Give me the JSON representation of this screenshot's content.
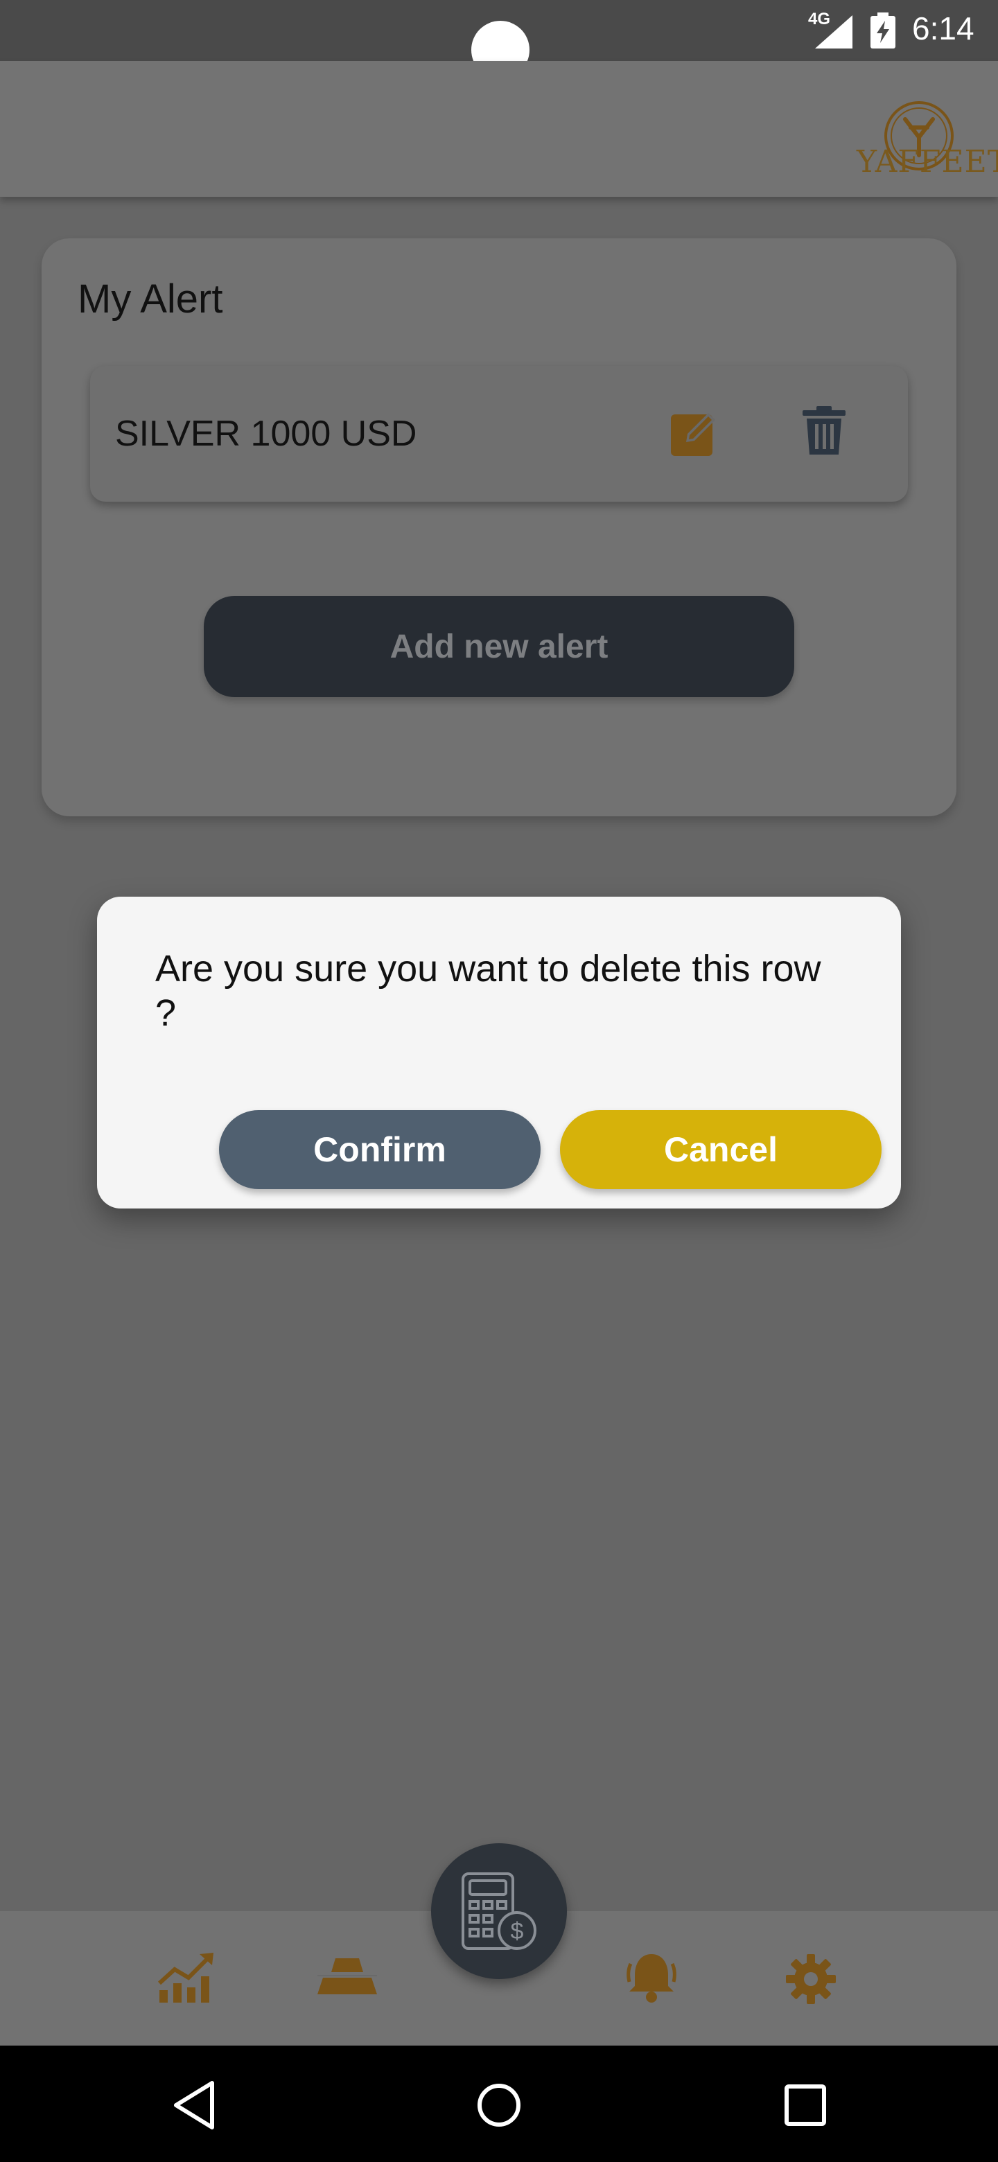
{
  "status_bar": {
    "network": "4G",
    "time": "6:14"
  },
  "app_bar": {
    "logo_text": "YAFFEET"
  },
  "alerts": {
    "title": "My Alert",
    "items": [
      {
        "label": "SILVER 1000 USD"
      }
    ],
    "add_button_label": "Add new alert"
  },
  "dialog": {
    "message": "Are you sure you want to delete this row ?",
    "confirm_label": "Confirm",
    "cancel_label": "Cancel"
  },
  "bottom_nav": {
    "items": [
      "chart-up-icon",
      "gold-bars-icon",
      "calculator-dollar-icon",
      "bell-icon",
      "gear-icon"
    ]
  },
  "colors": {
    "accent_gold": "#d6b20a",
    "icon_brown": "#7a5418",
    "confirm_blue": "#506070",
    "dark_button": "#272c33"
  }
}
